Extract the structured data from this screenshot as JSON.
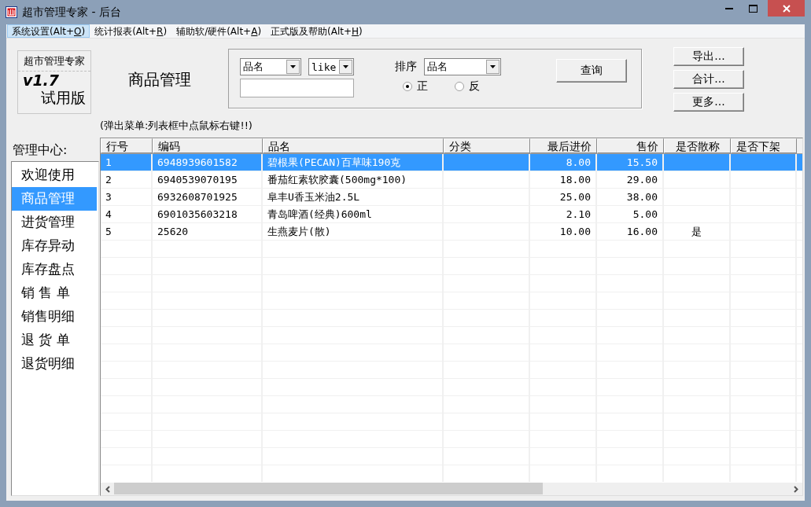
{
  "window": {
    "title": "超市管理专家 - 后台"
  },
  "menu": [
    {
      "label": "系统设置(Alt+",
      "accelerator": "O",
      "close": ")",
      "selected": true
    },
    {
      "label": "统计报表(Alt+",
      "accelerator": "R",
      "close": ")",
      "selected": false
    },
    {
      "label": "辅助软/硬件(Alt+",
      "accelerator": "A",
      "close": ")",
      "selected": false
    },
    {
      "label": "正式版及帮助(Alt+",
      "accelerator": "H",
      "close": ")",
      "selected": false
    }
  ],
  "logo": {
    "name": "超市管理专家",
    "version": "v1.7",
    "edition": "试用版"
  },
  "page_title": "商品管理",
  "search": {
    "field": "品名",
    "operator": "like",
    "sort_label": "排序",
    "sort_field": "品名",
    "order": [
      {
        "label": "正",
        "selected": true
      },
      {
        "label": "反",
        "selected": false
      }
    ],
    "query_button": "查询"
  },
  "actions": [
    "导出...",
    "合计...",
    "更多..."
  ],
  "hint": "(弹出菜单:列表框中点鼠标右键!!)",
  "sidebar": {
    "title": "管理中心:",
    "items": [
      {
        "label": "欢迎使用",
        "selected": false
      },
      {
        "label": "商品管理",
        "selected": true
      },
      {
        "label": "进货管理",
        "selected": false
      },
      {
        "label": "库存异动",
        "selected": false
      },
      {
        "label": "库存盘点",
        "selected": false
      },
      {
        "label": "销 售 单",
        "selected": false
      },
      {
        "label": "销售明细",
        "selected": false
      },
      {
        "label": "退 货 单",
        "selected": false
      },
      {
        "label": "退货明细",
        "selected": false
      }
    ]
  },
  "table": {
    "columns": [
      "行号",
      "编码",
      "品名",
      "分类",
      "最后进价",
      "售价",
      "是否散称",
      "是否下架"
    ],
    "rows": [
      {
        "cells": [
          "1",
          "6948939601582",
          "碧根果(PECAN)百草味190克",
          "",
          "8.00",
          "15.50",
          "",
          ""
        ],
        "selected": true
      },
      {
        "cells": [
          "2",
          "6940539070195",
          "番茄红素软胶囊(500mg*100)",
          "",
          "18.00",
          "29.00",
          "",
          ""
        ],
        "selected": false
      },
      {
        "cells": [
          "3",
          "6932608701925",
          "阜丰U香玉米油2.5L",
          "",
          "25.00",
          "38.00",
          "",
          ""
        ],
        "selected": false
      },
      {
        "cells": [
          "4",
          "6901035603218",
          "青岛啤酒(经典)600ml",
          "",
          "2.10",
          "5.00",
          "",
          ""
        ],
        "selected": false
      },
      {
        "cells": [
          "5",
          "25620",
          "生燕麦片(散)",
          "",
          "10.00",
          "16.00",
          "是",
          ""
        ],
        "selected": false
      }
    ]
  }
}
